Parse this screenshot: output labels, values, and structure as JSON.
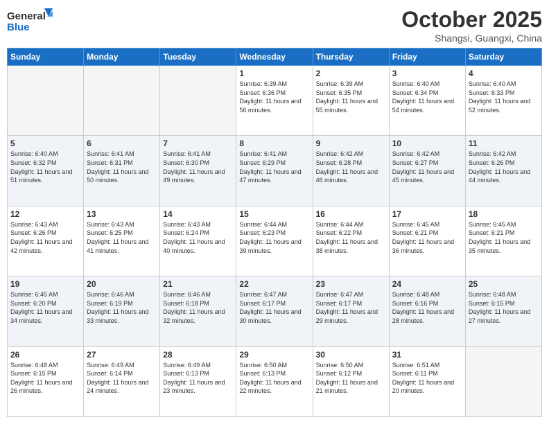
{
  "header": {
    "logo_general": "General",
    "logo_blue": "Blue",
    "month": "October 2025",
    "location": "Shangsi, Guangxi, China"
  },
  "days_of_week": [
    "Sunday",
    "Monday",
    "Tuesday",
    "Wednesday",
    "Thursday",
    "Friday",
    "Saturday"
  ],
  "weeks": [
    [
      {
        "day": "",
        "empty": true
      },
      {
        "day": "",
        "empty": true
      },
      {
        "day": "",
        "empty": true
      },
      {
        "day": "1",
        "sunrise": "6:39 AM",
        "sunset": "6:36 PM",
        "daylight": "11 hours and 56 minutes."
      },
      {
        "day": "2",
        "sunrise": "6:39 AM",
        "sunset": "6:35 PM",
        "daylight": "11 hours and 55 minutes."
      },
      {
        "day": "3",
        "sunrise": "6:40 AM",
        "sunset": "6:34 PM",
        "daylight": "11 hours and 54 minutes."
      },
      {
        "day": "4",
        "sunrise": "6:40 AM",
        "sunset": "6:33 PM",
        "daylight": "11 hours and 52 minutes."
      }
    ],
    [
      {
        "day": "5",
        "sunrise": "6:40 AM",
        "sunset": "6:32 PM",
        "daylight": "11 hours and 51 minutes."
      },
      {
        "day": "6",
        "sunrise": "6:41 AM",
        "sunset": "6:31 PM",
        "daylight": "11 hours and 50 minutes."
      },
      {
        "day": "7",
        "sunrise": "6:41 AM",
        "sunset": "6:30 PM",
        "daylight": "11 hours and 49 minutes."
      },
      {
        "day": "8",
        "sunrise": "6:41 AM",
        "sunset": "6:29 PM",
        "daylight": "11 hours and 47 minutes."
      },
      {
        "day": "9",
        "sunrise": "6:42 AM",
        "sunset": "6:28 PM",
        "daylight": "11 hours and 46 minutes."
      },
      {
        "day": "10",
        "sunrise": "6:42 AM",
        "sunset": "6:27 PM",
        "daylight": "11 hours and 45 minutes."
      },
      {
        "day": "11",
        "sunrise": "6:42 AM",
        "sunset": "6:26 PM",
        "daylight": "11 hours and 44 minutes."
      }
    ],
    [
      {
        "day": "12",
        "sunrise": "6:43 AM",
        "sunset": "6:26 PM",
        "daylight": "11 hours and 42 minutes."
      },
      {
        "day": "13",
        "sunrise": "6:43 AM",
        "sunset": "6:25 PM",
        "daylight": "11 hours and 41 minutes."
      },
      {
        "day": "14",
        "sunrise": "6:43 AM",
        "sunset": "6:24 PM",
        "daylight": "11 hours and 40 minutes."
      },
      {
        "day": "15",
        "sunrise": "6:44 AM",
        "sunset": "6:23 PM",
        "daylight": "11 hours and 39 minutes."
      },
      {
        "day": "16",
        "sunrise": "6:44 AM",
        "sunset": "6:22 PM",
        "daylight": "11 hours and 38 minutes."
      },
      {
        "day": "17",
        "sunrise": "6:45 AM",
        "sunset": "6:21 PM",
        "daylight": "11 hours and 36 minutes."
      },
      {
        "day": "18",
        "sunrise": "6:45 AM",
        "sunset": "6:21 PM",
        "daylight": "11 hours and 35 minutes."
      }
    ],
    [
      {
        "day": "19",
        "sunrise": "6:45 AM",
        "sunset": "6:20 PM",
        "daylight": "11 hours and 34 minutes."
      },
      {
        "day": "20",
        "sunrise": "6:46 AM",
        "sunset": "6:19 PM",
        "daylight": "11 hours and 33 minutes."
      },
      {
        "day": "21",
        "sunrise": "6:46 AM",
        "sunset": "6:18 PM",
        "daylight": "11 hours and 32 minutes."
      },
      {
        "day": "22",
        "sunrise": "6:47 AM",
        "sunset": "6:17 PM",
        "daylight": "11 hours and 30 minutes."
      },
      {
        "day": "23",
        "sunrise": "6:47 AM",
        "sunset": "6:17 PM",
        "daylight": "11 hours and 29 minutes."
      },
      {
        "day": "24",
        "sunrise": "6:48 AM",
        "sunset": "6:16 PM",
        "daylight": "11 hours and 28 minutes."
      },
      {
        "day": "25",
        "sunrise": "6:48 AM",
        "sunset": "6:15 PM",
        "daylight": "11 hours and 27 minutes."
      }
    ],
    [
      {
        "day": "26",
        "sunrise": "6:48 AM",
        "sunset": "6:15 PM",
        "daylight": "11 hours and 26 minutes."
      },
      {
        "day": "27",
        "sunrise": "6:49 AM",
        "sunset": "6:14 PM",
        "daylight": "11 hours and 24 minutes."
      },
      {
        "day": "28",
        "sunrise": "6:49 AM",
        "sunset": "6:13 PM",
        "daylight": "11 hours and 23 minutes."
      },
      {
        "day": "29",
        "sunrise": "6:50 AM",
        "sunset": "6:13 PM",
        "daylight": "11 hours and 22 minutes."
      },
      {
        "day": "30",
        "sunrise": "6:50 AM",
        "sunset": "6:12 PM",
        "daylight": "11 hours and 21 minutes."
      },
      {
        "day": "31",
        "sunrise": "6:51 AM",
        "sunset": "6:11 PM",
        "daylight": "11 hours and 20 minutes."
      },
      {
        "day": "",
        "empty": true
      }
    ]
  ],
  "labels": {
    "sunrise_prefix": "Sunrise: ",
    "sunset_prefix": "Sunset: ",
    "daylight_prefix": "Daylight: "
  }
}
